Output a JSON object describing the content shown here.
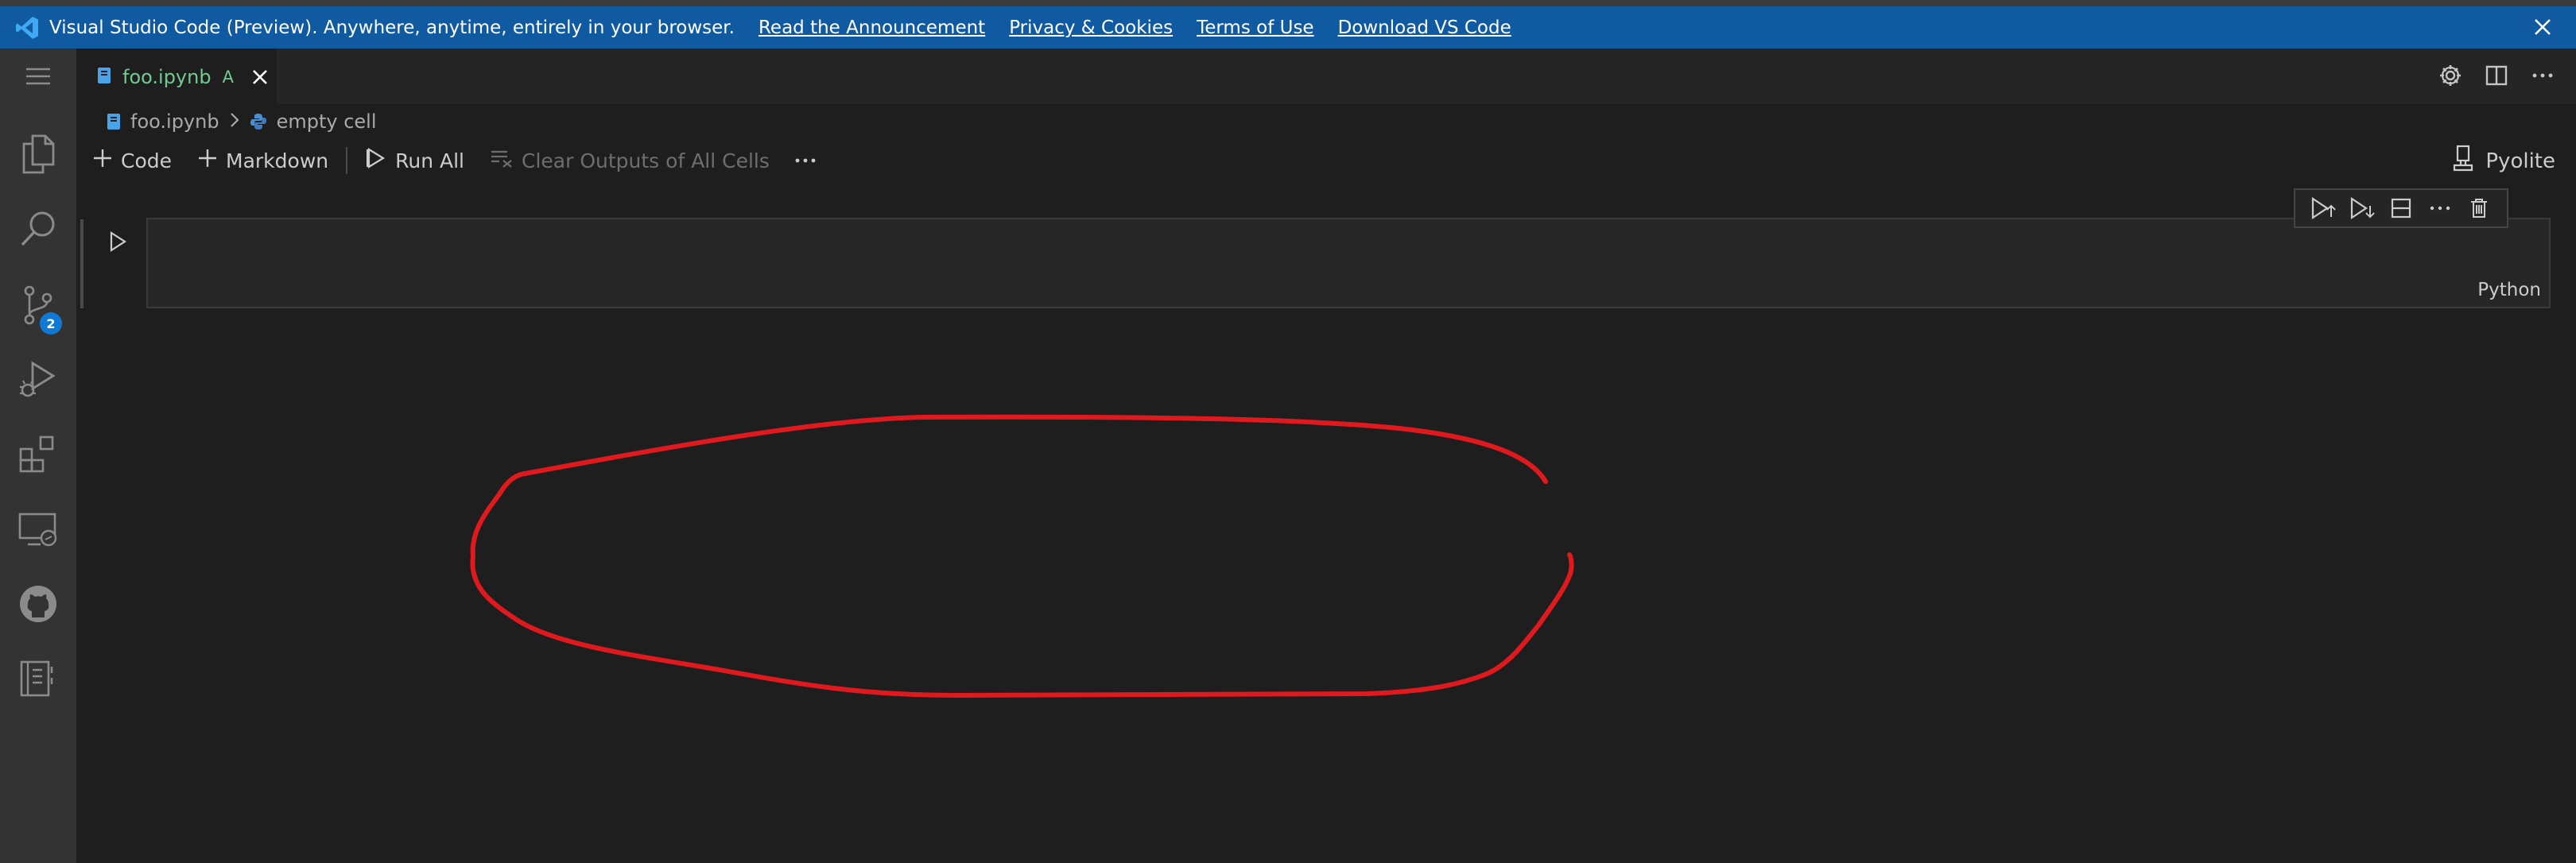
{
  "banner": {
    "message": "Visual Studio Code (Preview). Anywhere, anytime, entirely in your browser.",
    "links": [
      "Read the Announcement",
      "Privacy & Cookies",
      "Terms of Use",
      "Download VS Code"
    ],
    "close_icon": "close-icon"
  },
  "activity_bar": {
    "items": [
      "explorer-icon",
      "search-icon",
      "source-control-icon",
      "run-debug-icon",
      "extensions-icon",
      "remote-explorer-icon",
      "github-icon",
      "notebook-icon"
    ],
    "source_control_badge": "2"
  },
  "tab": {
    "filename": "foo.ipynb",
    "status": "A"
  },
  "breadcrumb": {
    "file": "foo.ipynb",
    "cell": "empty cell"
  },
  "notebook_toolbar": {
    "code_label": "Code",
    "markdown_label": "Markdown",
    "run_all_label": "Run All",
    "clear_outputs_label": "Clear Outputs of All Cells",
    "kernel_label": "Pyolite"
  },
  "cell": {
    "language": "Python"
  },
  "colors": {
    "banner": "#0f5aa0",
    "badge": "#0e7ad3",
    "modified_text": "#73c991",
    "annotation": "#e0191e"
  }
}
